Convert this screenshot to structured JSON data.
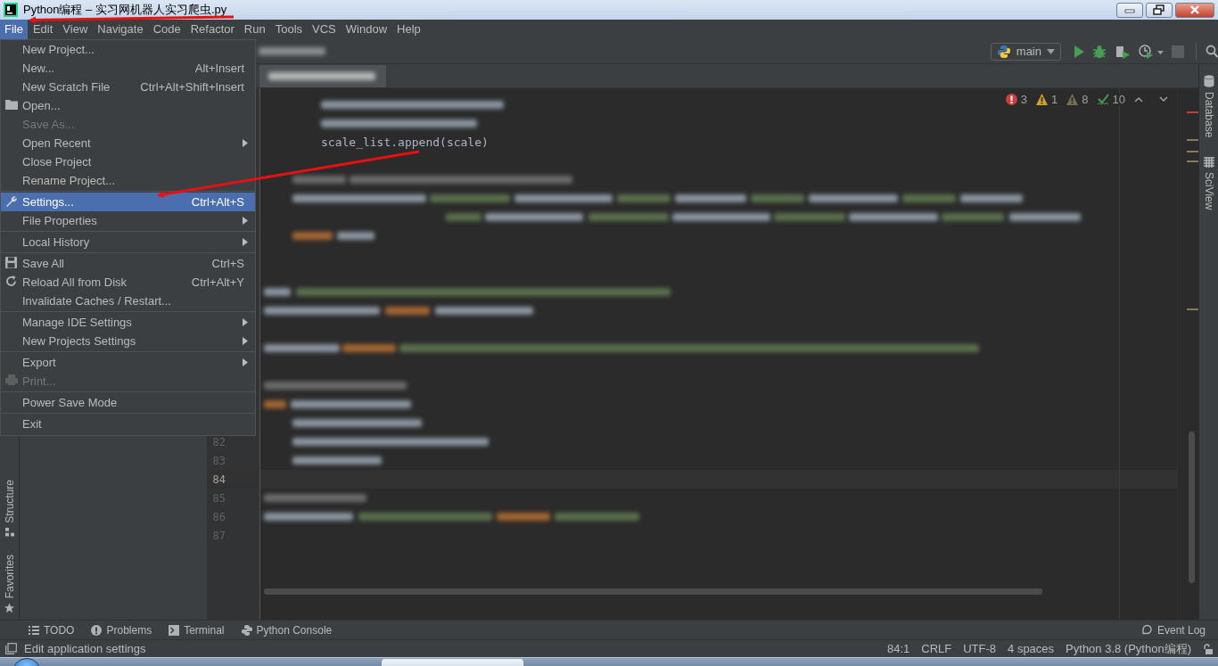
{
  "window": {
    "title": "Python编程 – 实习网机器人实习爬虫.py"
  },
  "menu_bar": [
    {
      "label": "File",
      "selected": true
    },
    {
      "label": "Edit",
      "selected": false
    },
    {
      "label": "View",
      "selected": false
    },
    {
      "label": "Navigate",
      "selected": false
    },
    {
      "label": "Code",
      "selected": false
    },
    {
      "label": "Refactor",
      "selected": false
    },
    {
      "label": "Run",
      "selected": false
    },
    {
      "label": "Tools",
      "selected": false
    },
    {
      "label": "VCS",
      "selected": false
    },
    {
      "label": "Window",
      "selected": false
    },
    {
      "label": "Help",
      "selected": false
    }
  ],
  "file_menu": [
    [
      {
        "label": "New Project...",
        "disabled": false,
        "selected": false,
        "submenu": false
      },
      {
        "label": "New...",
        "shortcut": "Alt+Insert",
        "disabled": false,
        "selected": false,
        "submenu": false
      },
      {
        "label": "New Scratch File",
        "shortcut": "Ctrl+Alt+Shift+Insert",
        "disabled": false,
        "selected": false,
        "submenu": false
      },
      {
        "label": "Open...",
        "disabled": false,
        "selected": false,
        "submenu": false
      },
      {
        "label": "Save As...",
        "disabled": true,
        "selected": false,
        "submenu": false
      },
      {
        "label": "Open Recent",
        "disabled": false,
        "selected": false,
        "submenu": true
      },
      {
        "label": "Close Project",
        "disabled": false,
        "selected": false,
        "submenu": false
      },
      {
        "label": "Rename Project...",
        "disabled": false,
        "selected": false,
        "submenu": false
      }
    ],
    [
      {
        "label": "Settings...",
        "shortcut": "Ctrl+Alt+S",
        "disabled": false,
        "selected": true,
        "submenu": false
      },
      {
        "label": "File Properties",
        "disabled": false,
        "selected": false,
        "submenu": true
      }
    ],
    [
      {
        "label": "Local History",
        "disabled": false,
        "selected": false,
        "submenu": true
      }
    ],
    [
      {
        "label": "Save All",
        "shortcut": "Ctrl+S",
        "disabled": false,
        "selected": false,
        "submenu": false
      },
      {
        "label": "Reload All from Disk",
        "shortcut": "Ctrl+Alt+Y",
        "disabled": false,
        "selected": false,
        "submenu": false
      },
      {
        "label": "Invalidate Caches / Restart...",
        "disabled": false,
        "selected": false,
        "submenu": false
      }
    ],
    [
      {
        "label": "Manage IDE Settings",
        "disabled": false,
        "selected": false,
        "submenu": true
      },
      {
        "label": "New Projects Settings",
        "disabled": false,
        "selected": false,
        "submenu": true
      }
    ],
    [
      {
        "label": "Export",
        "disabled": false,
        "selected": false,
        "submenu": true
      },
      {
        "label": "Print...",
        "disabled": true,
        "selected": false,
        "submenu": false
      }
    ],
    [
      {
        "label": "Power Save Mode",
        "disabled": false,
        "selected": false,
        "submenu": false
      }
    ],
    [
      {
        "label": "Exit",
        "disabled": false,
        "selected": false,
        "submenu": false
      }
    ]
  ],
  "toolbar": {
    "run_configuration": "main"
  },
  "inspections": [
    {
      "kind": "error",
      "count": "3"
    },
    {
      "kind": "warning",
      "count": "1"
    },
    {
      "kind": "weak",
      "count": "8"
    },
    {
      "kind": "typo",
      "count": "10"
    }
  ],
  "editor": {
    "visible_code": "scale_list.append(scale)",
    "line_numbers": [
      {
        "number": "82",
        "current": false
      },
      {
        "number": "83",
        "current": false
      },
      {
        "number": "84",
        "current": true
      },
      {
        "number": "85",
        "current": false
      },
      {
        "number": "86",
        "current": false
      },
      {
        "number": "87",
        "current": false
      }
    ]
  },
  "left_tool_windows": [
    "Structure",
    "Favorites"
  ],
  "right_tool_windows": [
    "Database",
    "SciView"
  ],
  "bottom_tool_windows": [
    "TODO",
    "Problems",
    "Terminal",
    "Python Console"
  ],
  "event_log": "Event Log",
  "status_bar": {
    "message": "Edit application settings",
    "items": [
      "84:1",
      "CRLF",
      "UTF-8",
      "4 spaces",
      "Python 3.8 (Python编程)"
    ]
  }
}
